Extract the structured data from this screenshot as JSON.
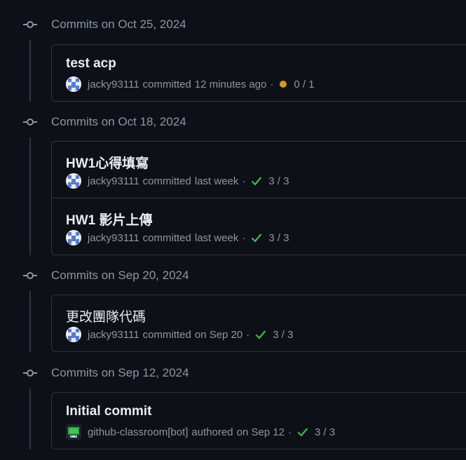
{
  "colors": {
    "background": "#0d1117",
    "border": "#30363d",
    "muted": "#8d96a0",
    "success": "#3fb950",
    "pending": "#d29922"
  },
  "groups": [
    {
      "title": "Commits on Oct 25, 2024",
      "commits": [
        {
          "message": "test acp",
          "author": "jacky93111",
          "verb": "committed",
          "when": "12 minutes ago",
          "separator": "·",
          "status_icon": "pending-dot-icon",
          "checks": "0 / 1"
        }
      ]
    },
    {
      "title": "Commits on Oct 18, 2024",
      "commits": [
        {
          "message": "HW1心得填寫",
          "author": "jacky93111",
          "verb": "committed",
          "when": "last week",
          "separator": "·",
          "status_icon": "check-icon",
          "checks": "3 / 3"
        },
        {
          "message": "HW1 影片上傳",
          "author": "jacky93111",
          "verb": "committed",
          "when": "last week",
          "separator": "·",
          "status_icon": "check-icon",
          "checks": "3 / 3"
        }
      ]
    },
    {
      "title": "Commits on Sep 20, 2024",
      "commits": [
        {
          "message": "更改團隊代碼",
          "author": "jacky93111",
          "verb": "committed",
          "when": "on Sep 20",
          "separator": "·",
          "status_icon": "check-icon",
          "checks": "3 / 3"
        }
      ]
    },
    {
      "title": "Commits on Sep 12, 2024",
      "commits": [
        {
          "message": "Initial commit",
          "author": "github-classroom[bot]",
          "verb": "authored",
          "when": "on Sep 12",
          "separator": "·",
          "status_icon": "check-icon",
          "checks": "3 / 3"
        }
      ]
    }
  ]
}
